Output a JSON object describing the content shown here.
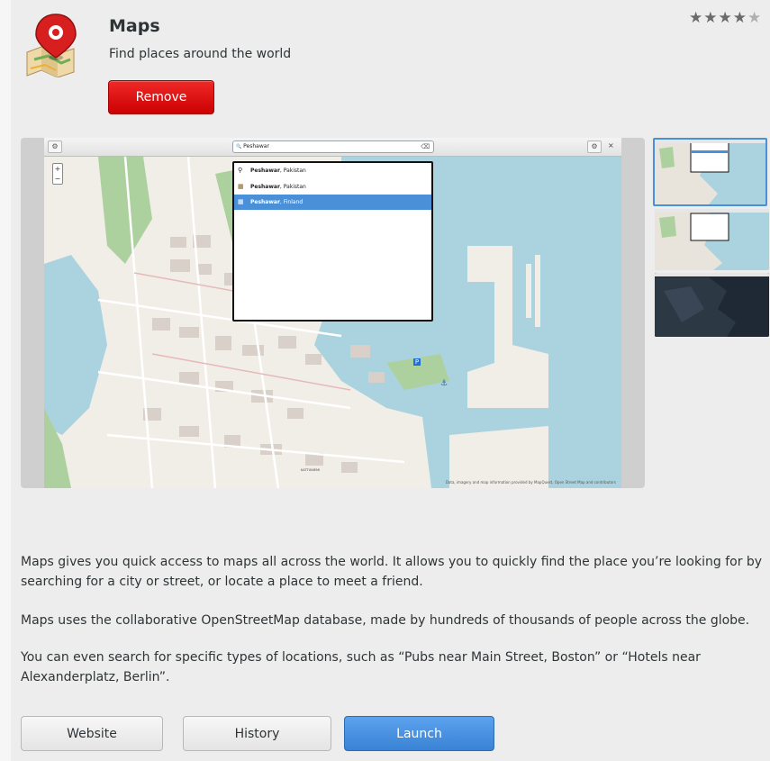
{
  "app": {
    "title": "Maps",
    "summary": "Find places around the world",
    "icon": "maps-pin-icon",
    "rating_stars": 4.5,
    "rating_max": 5,
    "rating_glyphs": {
      "full": "★",
      "half": "★"
    }
  },
  "actions": {
    "remove_label": "Remove",
    "website_label": "Website",
    "history_label": "History",
    "launch_label": "Launch"
  },
  "screenshot": {
    "search_value": "Peshawar",
    "search_icon_glyph": "🔍",
    "clear_glyph": "⌫",
    "settings_glyph": "⚙",
    "close_glyph": "×",
    "zoom_in_glyph": "+",
    "zoom_out_glyph": "−",
    "results": [
      {
        "name": "Peshawar",
        "region": ", Pakistan",
        "icon": "place-icon",
        "glyph": "⚲"
      },
      {
        "name": "Peshawar",
        "region": ", Pakistan",
        "icon": "city-icon",
        "glyph": "▦"
      },
      {
        "name": "Peshawar",
        "region": ", Finland",
        "icon": "district-icon",
        "glyph": "▦",
        "selected": true
      }
    ],
    "attribution": "Data, imagery and map information provided by MapQuest, Open Street Map and contributors",
    "map_labels": [
      "KATTUNIEMI"
    ],
    "thumbnail_count": 3,
    "selected_thumbnail": 1
  },
  "description": {
    "paragraph_1": "Maps gives you quick access to maps all across the world. It allows you to quickly find the place you’re looking for by searching for a city or street, or locate a place to meet a friend.",
    "paragraph_2": "Maps uses the collaborative OpenStreetMap database, made by hundreds of thousands of people across the globe.",
    "paragraph_3": "You can even search for specific types of locations, such as “Pubs near Main Street, Boston” or “Hotels near Alexanderplatz, Berlin”."
  },
  "colors": {
    "remove": "#cc0000",
    "launch": "#3a82d4",
    "selection": "#4a90d9",
    "water": "#aad3df",
    "park": "#add19e"
  }
}
